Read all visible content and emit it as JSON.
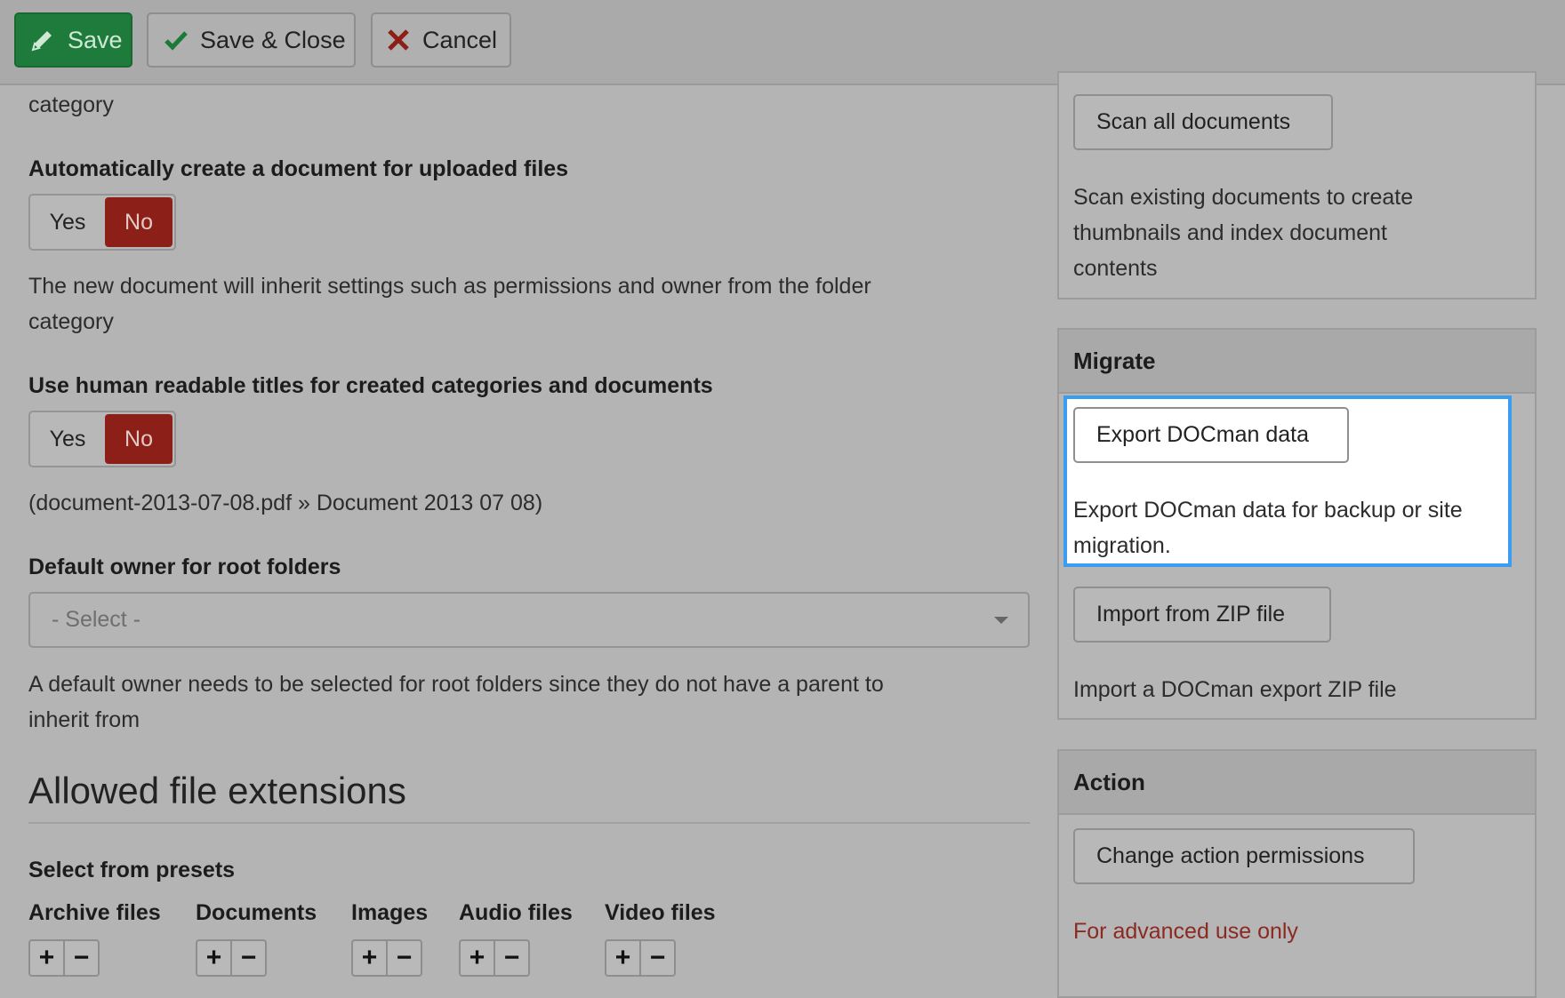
{
  "toolbar": {
    "save": "Save",
    "save_close": "Save & Close",
    "cancel": "Cancel"
  },
  "left": {
    "top_fragment": "category",
    "auto_create_label": "Automatically create a document for uploaded files",
    "auto_create_yes": "Yes",
    "auto_create_no": "No",
    "auto_create_help_line1": "The new document will inherit settings such as permissions and owner from the folder",
    "auto_create_help_line2": "category",
    "readable_label": "Use human readable titles for created categories and documents",
    "readable_yes": "Yes",
    "readable_no": "No",
    "readable_example": "(document-2013-07-08.pdf » Document 2013 07 08)",
    "owner_label": "Default owner for root folders",
    "owner_select_value": "- Select -",
    "owner_help_line1": "A default owner needs to be selected for root folders since they do not have a parent to",
    "owner_help_line2": "inherit from",
    "extensions_heading": "Allowed file extensions",
    "presets_label": "Select from presets",
    "presets": [
      "Archive files",
      "Documents",
      "Images",
      "Audio files",
      "Video files"
    ],
    "plus": "+",
    "minus": "−"
  },
  "right": {
    "scan_button": "Scan all documents",
    "scan_help_line1": "Scan existing documents to create",
    "scan_help_line2": "thumbnails and index document",
    "scan_help_line3": "contents",
    "migrate_title": "Migrate",
    "export_button": "Export DOCman data",
    "export_help_line1": "Export DOCman data for backup or site",
    "export_help_line2": "migration.",
    "import_button": "Import from ZIP file",
    "import_help": "Import a DOCman export ZIP file",
    "action_title": "Action",
    "permissions_button": "Change action permissions",
    "advanced_note": "For advanced use only"
  },
  "colors": {
    "save_green": "#1e7b3c",
    "toggle_no_red": "#8c2019",
    "highlight_blue": "#3b9cf0",
    "advanced_red": "#8b2a22"
  },
  "icons": {
    "save": "pencil-icon",
    "save_close": "checkmark-icon",
    "cancel": "x-icon",
    "select_caret": "caret-down-icon"
  }
}
